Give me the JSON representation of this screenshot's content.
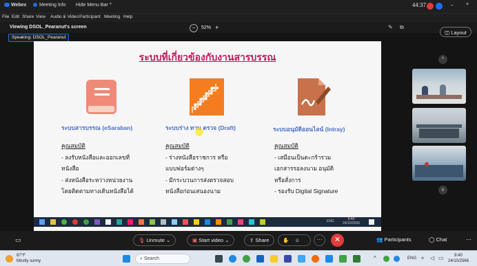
{
  "titlebar": {
    "app_name": "Webex",
    "meeting_info": "Meeting Info",
    "hide_menu": "Hide Menu Bar",
    "timer": "44:37"
  },
  "menu": [
    "File",
    "Edit",
    "Share",
    "View",
    "Audio & Video",
    "Participant",
    "Meeting",
    "Help"
  ],
  "view": {
    "viewing": "Viewing DSOL_Pearanut's screen",
    "zoom": "52%",
    "speaking": "Speaking: DSOL_Pearanut",
    "layout": "Layout"
  },
  "slide": {
    "title": "ระบบที่เกี่ยวข้องกับงานสารบรรณ",
    "columns": [
      {
        "heading": "ระบบสารบรรณ (eSaraban)",
        "props_label": "คุณสมบัติ",
        "lines": [
          "- ลงรับหนังสือและออกเลขที่",
          "หนังสือ",
          "- ส่งหนังสือระหว่างหน่วยงาน",
          "โดยติดตามทางเดินหนังสือได้"
        ]
      },
      {
        "heading": "ระบบร่าง ทาน ตรวจ (Draft)",
        "props_label": "คุณสมบัติ",
        "lines": [
          "- ร่างหนังสือราชการ หรือ",
          "แบบฟอร์มต่างๆ",
          "- มีกระบวนการส่งตรวจสอบ",
          "หนังสือก่อนเสนองนาม"
        ]
      },
      {
        "heading": "ระบบอนุมัติออนไลน์ (Intray)",
        "props_label": "คุณสมบัติ",
        "lines": [
          "- เสมือนเป็นตะกร้ารวม",
          "เอกสารรอลงนาม อนุมัติ",
          "หรือสั่งการ",
          "- รองรับ Digital Signature"
        ]
      }
    ],
    "inner_clock": "9:40",
    "inner_date": "24/10/2566",
    "inner_lang": "ENG"
  },
  "controls": {
    "unmute": "Unmute",
    "start_video": "Start video",
    "share": "Share",
    "participants": "Participants",
    "chat": "Chat"
  },
  "os_taskbar": {
    "weather_temp": "87°F",
    "weather_desc": "Mostly sunny",
    "search": "Search",
    "lang": "ENG",
    "clock": "9:40",
    "date": "24/10/2566"
  },
  "colors": {
    "accent_blue": "#1e6ff0",
    "title_pink": "#c2185b",
    "icon_salmon": "#f08a78",
    "icon_orange": "#f57c1f",
    "icon_brown": "#c8714a",
    "heading_blue": "#4a6fc8",
    "end_red": "#e23a3a"
  }
}
